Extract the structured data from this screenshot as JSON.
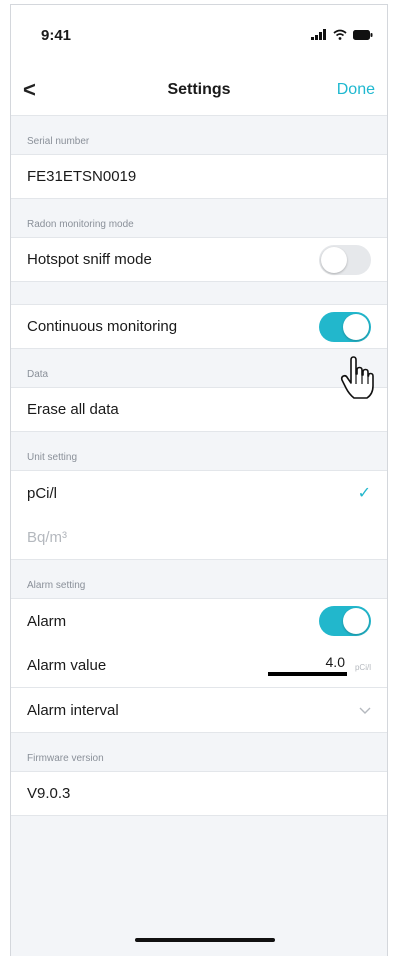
{
  "status": {
    "time": "9:41"
  },
  "nav": {
    "back": "<",
    "title": "Settings",
    "done": "Done"
  },
  "sections": {
    "serial": {
      "header": "Serial number",
      "value": "FE31ETSN0019"
    },
    "radon": {
      "header": "Radon monitoring mode",
      "hotspot": {
        "label": "Hotspot sniff mode",
        "on": false
      },
      "continuous": {
        "label": "Continuous monitoring",
        "on": true
      }
    },
    "data": {
      "header": "Data",
      "erase": "Erase all data"
    },
    "unit": {
      "header": "Unit setting",
      "pci": "pCi/l",
      "bq": "Bq/m³",
      "selected": "pCi/l"
    },
    "alarm": {
      "header": "Alarm setting",
      "alarm_label": "Alarm",
      "alarm_on": true,
      "value_label": "Alarm value",
      "value": "4.0",
      "value_unit": "pCi/l",
      "interval_label": "Alarm interval"
    },
    "firmware": {
      "header": "Firmware version",
      "value": "V9.0.3"
    }
  },
  "colors": {
    "accent": "#22b7cc",
    "done": "#1fb8d0",
    "toggle_off": "#e6e8eb"
  },
  "icons": [
    "signal-icon",
    "wifi-icon",
    "battery-icon",
    "back-chevron-icon",
    "checkmark-icon",
    "chevron-down-icon",
    "hand-cursor-icon"
  ]
}
